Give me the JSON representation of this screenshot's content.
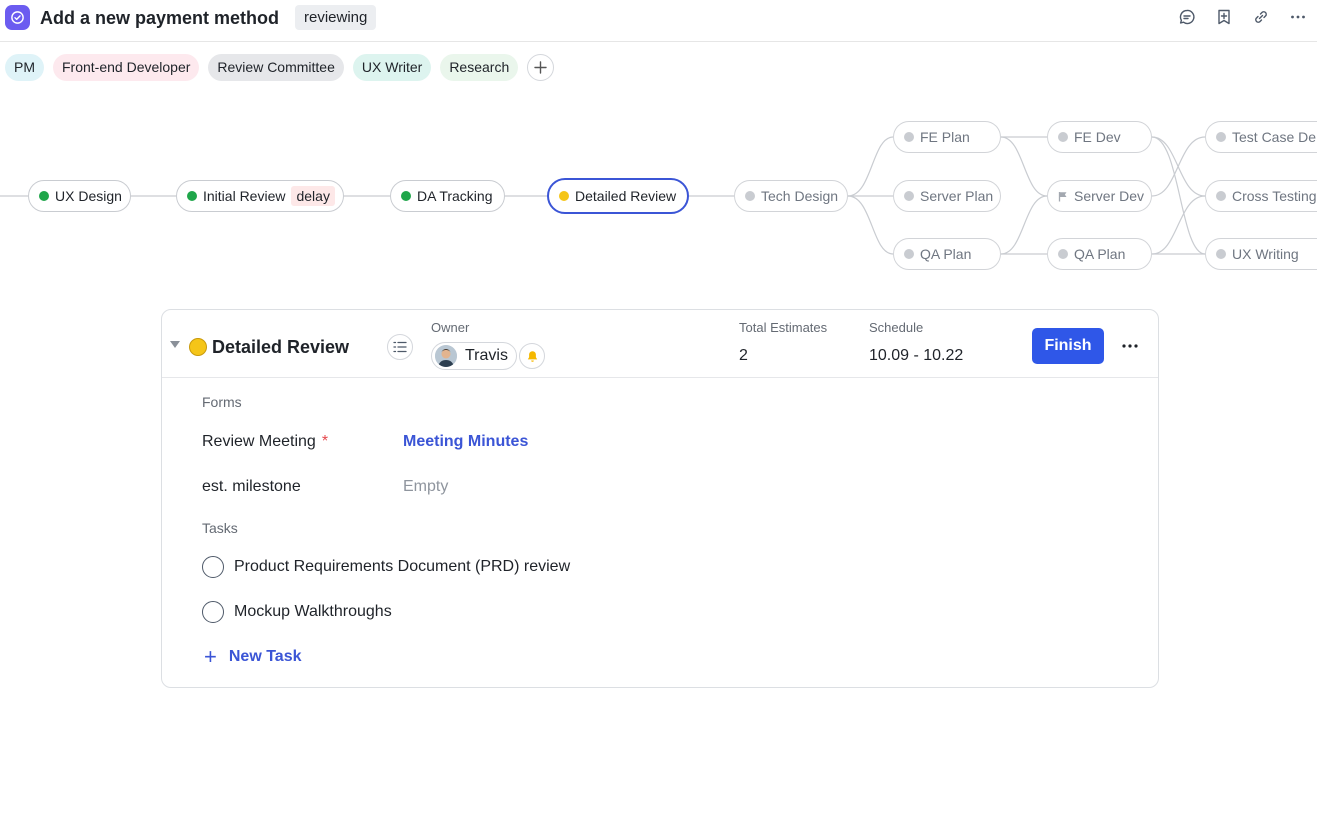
{
  "header": {
    "title": "Add a new payment method",
    "status": "reviewing",
    "icons": [
      "check-circle-icon",
      "comment-icon",
      "bookmark-add-icon",
      "link-icon",
      "more-icon"
    ]
  },
  "roles": [
    {
      "label": "PM",
      "bg": "#dff3f8"
    },
    {
      "label": "Front-end Developer",
      "bg": "#fde9ee"
    },
    {
      "label": "Review Committee",
      "bg": "#e6e7ea"
    },
    {
      "label": "UX Writer",
      "bg": "#ddf4ef"
    },
    {
      "label": "Research",
      "bg": "#eaf6ec"
    }
  ],
  "flow": {
    "nodes": [
      {
        "label": "UX Design",
        "state": "done"
      },
      {
        "label": "Initial Review",
        "state": "done",
        "badge": "delay"
      },
      {
        "label": "DA Tracking",
        "state": "done"
      },
      {
        "label": "Detailed Review",
        "state": "current"
      },
      {
        "label": "Tech Design",
        "state": "future"
      },
      {
        "label": "FE Plan",
        "state": "future"
      },
      {
        "label": "Server Plan",
        "state": "future"
      },
      {
        "label": "QA Plan",
        "state": "future"
      },
      {
        "label": "FE Dev",
        "state": "future"
      },
      {
        "label": "Server Dev",
        "state": "future",
        "icon": "flag-icon"
      },
      {
        "label": "QA Plan",
        "state": "future"
      },
      {
        "label": "Test Case De",
        "state": "future"
      },
      {
        "label": "Cross Testing",
        "state": "future"
      },
      {
        "label": "UX Writing",
        "state": "future"
      }
    ],
    "colors": {
      "done": "#1fa64a",
      "current": "#f5c518",
      "future": "#c9ccd1",
      "accent": "#3b55d6"
    }
  },
  "card": {
    "title": "Detailed Review",
    "owner_label": "Owner",
    "owner_name": "Travis",
    "estimates_label": "Total Estimates",
    "estimates_value": "2",
    "schedule_label": "Schedule",
    "schedule_value": "10.09 - 10.22",
    "finish_label": "Finish",
    "forms_label": "Forms",
    "fields": [
      {
        "label": "Review Meeting",
        "required": "*",
        "value": "Meeting Minutes"
      },
      {
        "label": "est. milestone",
        "value": "Empty"
      }
    ],
    "tasks_label": "Tasks",
    "tasks": [
      "Product Requirements Document (PRD) review",
      "Mockup Walkthroughs"
    ],
    "new_task_label": "New Task"
  }
}
